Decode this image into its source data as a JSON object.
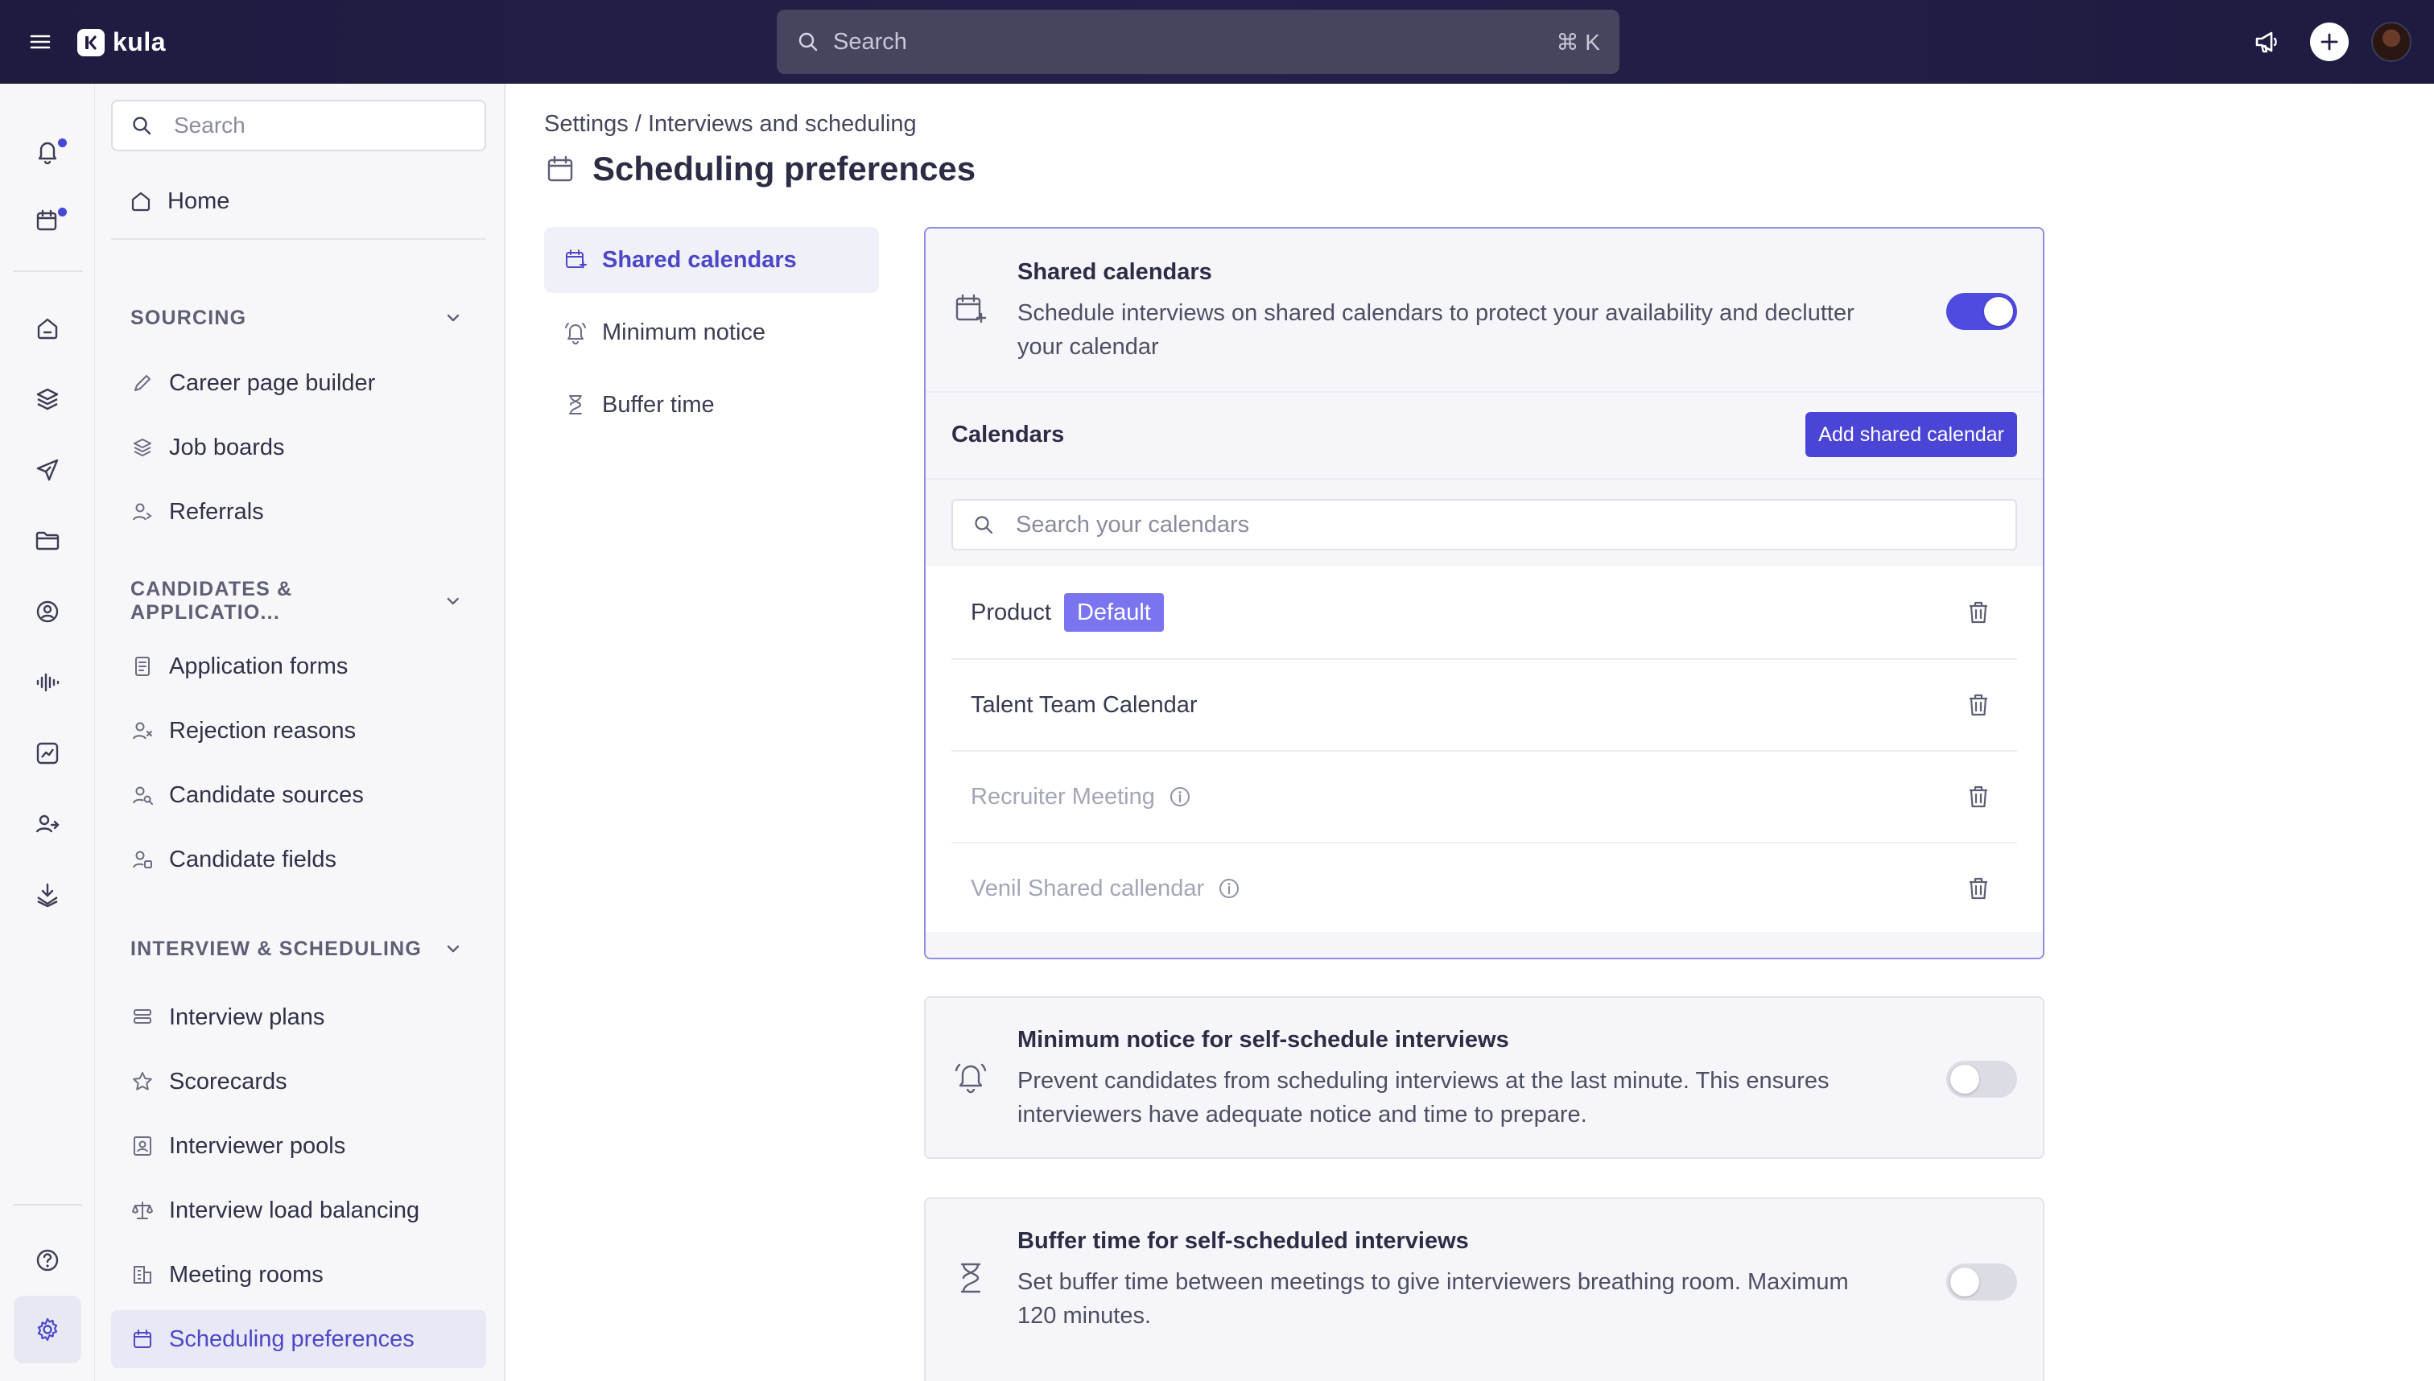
{
  "topbar": {
    "brand": "kula",
    "search_placeholder": "Search",
    "search_shortcut": "⌘ K"
  },
  "rail": {
    "items": [
      "notifications-icon",
      "calendar-icon",
      "home-icon",
      "layers-icon",
      "send-icon",
      "folder-icon",
      "user-circle-icon",
      "voice-icon",
      "analytics-icon",
      "users-icon",
      "inbox-icon",
      "help-icon",
      "settings-icon"
    ]
  },
  "sidebar": {
    "search_placeholder": "Search",
    "home": "Home",
    "sections": [
      {
        "label": "SOURCING",
        "items": [
          "Career page builder",
          "Job boards",
          "Referrals"
        ]
      },
      {
        "label": "CANDIDATES & APPLICATIO...",
        "items": [
          "Application forms",
          "Rejection reasons",
          "Candidate sources",
          "Candidate fields"
        ]
      },
      {
        "label": "INTERVIEW & SCHEDULING",
        "items": [
          "Interview plans",
          "Scorecards",
          "Interviewer pools",
          "Interview load balancing",
          "Meeting rooms",
          "Scheduling preferences"
        ]
      }
    ]
  },
  "main": {
    "breadcrumb": "Settings / Interviews and scheduling",
    "title": "Scheduling preferences",
    "subnav": [
      "Shared calendars",
      "Minimum notice",
      "Buffer time"
    ],
    "shared_calendars": {
      "title": "Shared calendars",
      "description": "Schedule interviews on shared calendars to protect your availability and declutter your calendar",
      "enabled": true,
      "calendars_label": "Calendars",
      "add_button": "Add shared calendar",
      "search_placeholder": "Search your calendars",
      "default_badge": "Default",
      "calendars": [
        {
          "name": "Product",
          "default": true,
          "muted": false
        },
        {
          "name": "Talent Team Calendar",
          "default": false,
          "muted": false
        },
        {
          "name": "Recruiter Meeting",
          "default": false,
          "muted": true
        },
        {
          "name": "Venil Shared callendar",
          "default": false,
          "muted": true
        }
      ]
    },
    "minimum_notice": {
      "title": "Minimum notice for self-schedule interviews",
      "description": "Prevent candidates from scheduling interviews at the last minute. This ensures interviewers have adequate notice and time to prepare.",
      "enabled": false
    },
    "buffer_time": {
      "title": "Buffer time for self-scheduled interviews",
      "description": "Set buffer time between meetings to give interviewers breathing room. Maximum 120 minutes.",
      "enabled": false
    }
  },
  "colors": {
    "accent": "#4f4ae0",
    "topbar": "#1f1d44",
    "badge": "#7a74ee"
  }
}
